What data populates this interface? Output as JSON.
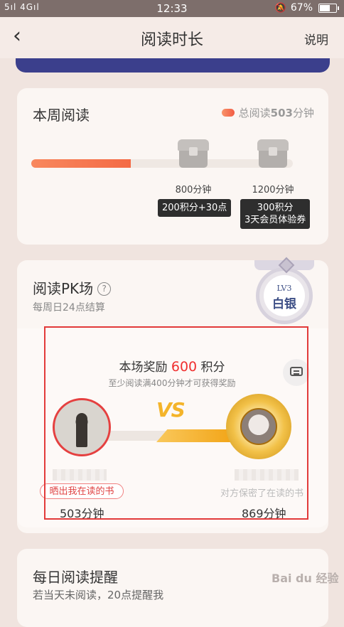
{
  "status": {
    "signal": "5ıl 4Gıl",
    "time": "12:33",
    "battery": "67%",
    "battery_level": 0.67
  },
  "nav": {
    "title": "阅读时长",
    "help": "说明"
  },
  "weekly": {
    "title": "本周阅读",
    "total_prefix": "总阅读",
    "total_value": "503",
    "total_suffix": "分钟",
    "progress": 0.38,
    "milestones": [
      {
        "label": "800分钟",
        "reward_line1": "200积分+30点",
        "reward_line2": ""
      },
      {
        "label": "1200分钟",
        "reward_line1": "300积分",
        "reward_line2": "3天会员体验券"
      }
    ]
  },
  "pk": {
    "title": "阅读PK场",
    "help_icon": "?",
    "subtitle": "每周日24点结算",
    "badge_level": "LV3",
    "badge_tier": "白银",
    "reward_prefix": "本场奖励",
    "reward_points": "600",
    "reward_unit": "积分",
    "reward_note": "至少阅读满400分钟才可获得奖励",
    "vs": "VS",
    "me": {
      "button": "晒出我在读的书",
      "minutes": "503分钟"
    },
    "opponent": {
      "hidden_note": "对方保密了在读的书",
      "minutes": "869分钟"
    }
  },
  "reminder": {
    "title": "每日阅读提醒",
    "subtitle": "若当天未阅读，20点提醒我"
  },
  "watermark": "Bai du 经验"
}
